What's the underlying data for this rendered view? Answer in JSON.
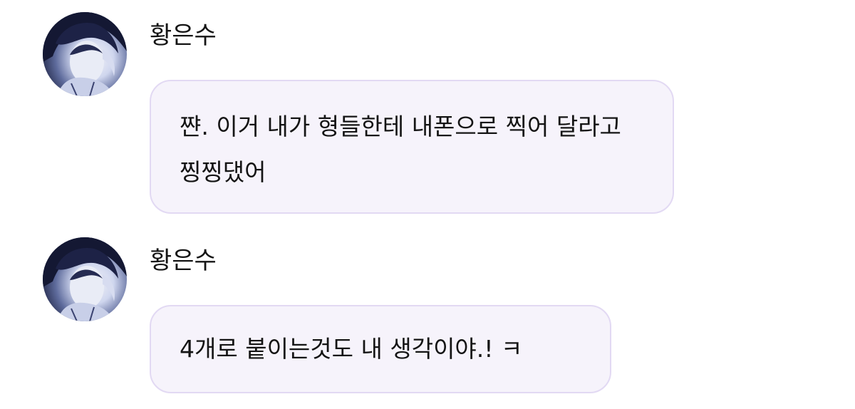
{
  "messages": [
    {
      "sender": "황은수",
      "avatar_icon": "user-avatar-photo",
      "text": "쨘. 이거 내가 형들한테 내폰으로 찍어 달라고 찡찡댔어"
    },
    {
      "sender": "황은수",
      "avatar_icon": "user-avatar-photo",
      "text": "4개로 붙이는것도 내 생각이야.! ㅋ"
    }
  ],
  "colors": {
    "background": "#ffffff",
    "bubble_fill": "#f6f3fb",
    "bubble_border": "#e2d9f3",
    "text": "#141414"
  }
}
